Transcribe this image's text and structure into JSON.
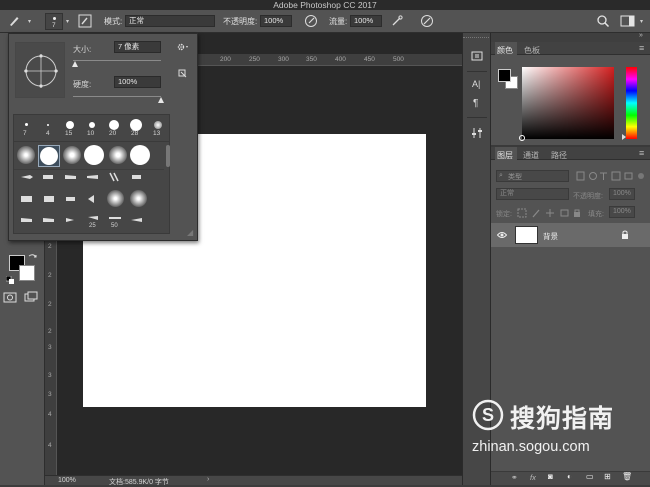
{
  "window": {
    "title": "Adobe Photoshop CC 2017"
  },
  "options_bar": {
    "brush_size": "7",
    "mode_label": "模式:",
    "mode_value": "正常",
    "opacity_label": "不透明度:",
    "opacity_value": "100%",
    "flow_label": "流量:",
    "flow_value": "100%"
  },
  "brush_popup": {
    "size_label": "大小:",
    "size_value": "7 像素",
    "hardness_label": "硬度:",
    "hardness_value": "100%",
    "size_slider_fraction": 0.02,
    "hardness_slider_fraction": 1.0,
    "preset_sizes": [
      "7",
      "4",
      "15",
      "10",
      "20",
      "28",
      "13"
    ],
    "row_labels": [
      "25",
      "50"
    ]
  },
  "rulers": {
    "top_ticks": [
      "200",
      "250",
      "300",
      "350",
      "400",
      "450",
      "500"
    ],
    "left_ticks": [
      "2",
      "2",
      "2",
      "2",
      "3",
      "3",
      "3",
      "4",
      "4"
    ]
  },
  "status_bar": {
    "zoom": "100%",
    "doc_info": "文档:585.9K/0 字节"
  },
  "color_panel": {
    "tabs": [
      "颜色",
      "色板"
    ],
    "foreground": "#000000",
    "background": "#ffffff",
    "field_hue": "#d42020"
  },
  "layers_panel": {
    "tabs": [
      "图层",
      "通道",
      "路径"
    ],
    "filter_kind": "类型",
    "blend_mode": "正常",
    "opacity_label": "不透明度:",
    "opacity_value": "100%",
    "lock_label": "锁定:",
    "fill_label": "填充:",
    "fill_value": "100%",
    "layers": [
      {
        "name": "背景",
        "visible": true,
        "locked": true
      }
    ]
  },
  "watermark": {
    "logo_text": "搜狗指南",
    "url": "zhinan.sogou.com"
  }
}
